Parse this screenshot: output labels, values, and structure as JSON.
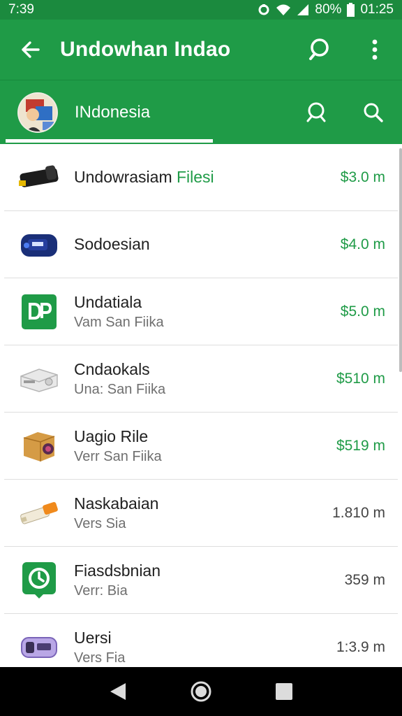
{
  "status_bar": {
    "time": "7:39",
    "battery": "80%",
    "clock_right": "01:25"
  },
  "app_bar": {
    "title": "Undowhan Indao"
  },
  "sub_bar": {
    "label": "INdonesia"
  },
  "items": [
    {
      "name": "Undowrasiam",
      "name_accent": "Filesi",
      "subtitle": "",
      "price": "$3.0 m",
      "price_color": "green",
      "icon": "dark-device-icon"
    },
    {
      "name": "Sodoesian",
      "name_accent": "",
      "subtitle": "",
      "price": "$4.0 m",
      "price_color": "green",
      "icon": "blue-gadget-icon"
    },
    {
      "name": "Undatiala",
      "name_accent": "",
      "subtitle": "Vam San Fiika",
      "price": "$5.0 m",
      "price_color": "green",
      "icon": "green-dp-app-icon"
    },
    {
      "name": "Cndaokals",
      "name_accent": "",
      "subtitle": "Una: San Fiika",
      "price": "$510 m",
      "price_color": "green",
      "icon": "white-box-device-icon"
    },
    {
      "name": "Uagio Rile",
      "name_accent": "",
      "subtitle": "Verr San Fiika",
      "price": "$519 m",
      "price_color": "green",
      "icon": "camera-box-icon"
    },
    {
      "name": "Naskabaian",
      "name_accent": "",
      "subtitle": "Vers Sia",
      "price": "1.810 m",
      "price_color": "gray",
      "icon": "usb-stick-icon"
    },
    {
      "name": "Fiasdsbnian",
      "name_accent": "",
      "subtitle": "Verr: Bia",
      "price": "359 m",
      "price_color": "gray",
      "icon": "green-clock-app-icon"
    },
    {
      "name": "Uersi",
      "name_accent": "",
      "subtitle": "Vers Fia",
      "price": "1:3.9 m",
      "price_color": "gray",
      "icon": "purple-gadget-icon"
    }
  ],
  "colors": {
    "primary": "#1f9b47",
    "status": "#1b8a3e",
    "accent_text": "#1f9b47"
  }
}
